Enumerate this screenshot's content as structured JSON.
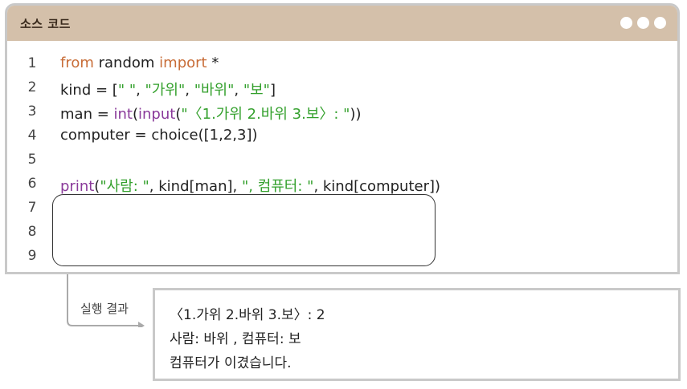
{
  "window": {
    "title": "소스 코드",
    "window_controls": [
      "dot-icon",
      "dot-icon",
      "dot-icon"
    ]
  },
  "code_lines": [
    {
      "number": "1",
      "tokens": [
        {
          "text": "from",
          "type": "keyword"
        },
        {
          "text": " random ",
          "type": "plain"
        },
        {
          "text": "import",
          "type": "keyword"
        },
        {
          "text": " *",
          "type": "plain"
        }
      ]
    },
    {
      "number": "2",
      "tokens": [
        {
          "text": "kind = [",
          "type": "plain"
        },
        {
          "text": "\" \"",
          "type": "string"
        },
        {
          "text": ", ",
          "type": "plain"
        },
        {
          "text": "\"가위\"",
          "type": "string"
        },
        {
          "text": ", ",
          "type": "plain"
        },
        {
          "text": "\"바위\"",
          "type": "string"
        },
        {
          "text": ", ",
          "type": "plain"
        },
        {
          "text": "\"보\"",
          "type": "string"
        },
        {
          "text": "]",
          "type": "plain"
        }
      ]
    },
    {
      "number": "3",
      "tokens": [
        {
          "text": "man = ",
          "type": "plain"
        },
        {
          "text": "int",
          "type": "function"
        },
        {
          "text": "(",
          "type": "plain"
        },
        {
          "text": "input",
          "type": "function"
        },
        {
          "text": "(",
          "type": "plain"
        },
        {
          "text": "\"〈1.가위 2.바위 3.보〉: \"",
          "type": "string"
        },
        {
          "text": "))",
          "type": "plain"
        }
      ]
    },
    {
      "number": "4",
      "tokens": [
        {
          "text": "computer = choice([1,2,3])",
          "type": "plain"
        }
      ]
    },
    {
      "number": "5",
      "tokens": []
    },
    {
      "number": "6",
      "tokens": [
        {
          "text": "print",
          "type": "function"
        },
        {
          "text": "(",
          "type": "plain"
        },
        {
          "text": "\"사람: \"",
          "type": "string"
        },
        {
          "text": ", kind[man], ",
          "type": "plain"
        },
        {
          "text": "\", 컴퓨터: \"",
          "type": "string"
        },
        {
          "text": ", kind[computer])",
          "type": "plain"
        }
      ]
    },
    {
      "number": "7",
      "tokens": []
    },
    {
      "number": "8",
      "tokens": []
    },
    {
      "number": "9",
      "tokens": []
    }
  ],
  "colors": {
    "keyword": "#c86d38",
    "function": "#8a3a9a",
    "string": "#33a02c",
    "titlebar": "#d4c0aa"
  },
  "run_result": {
    "label": "실행 결과",
    "lines": [
      "〈1.가위 2.바위 3.보〉: 2",
      "사람: 바위 , 컴퓨터: 보",
      "컴퓨터가 이겼습니다."
    ]
  }
}
